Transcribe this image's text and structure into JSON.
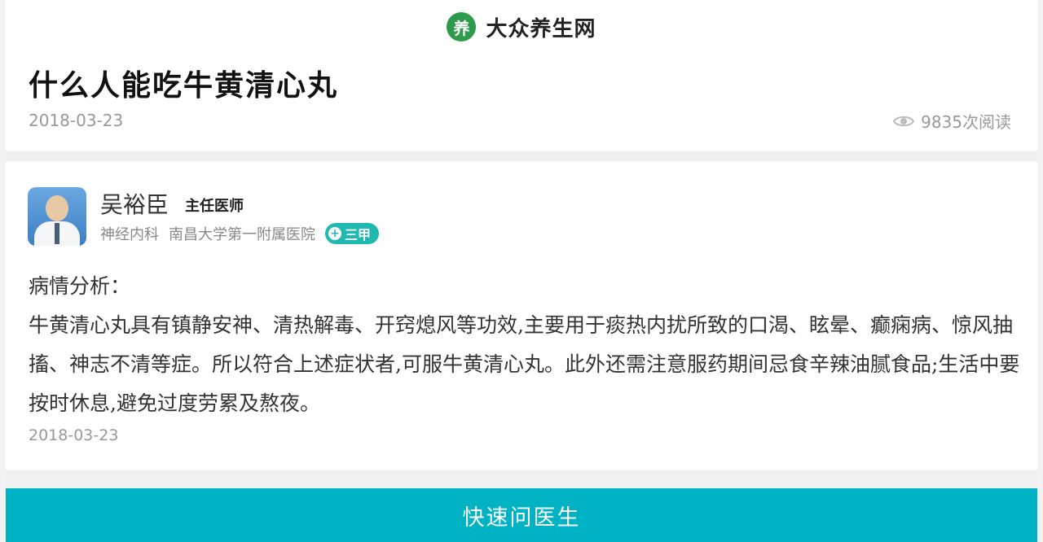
{
  "site": {
    "name": "大众养生网",
    "logo_char": "养"
  },
  "article": {
    "title": "什么人能吃牛黄清心丸",
    "date": "2018-03-23",
    "read_count": "9835次阅读"
  },
  "doctor": {
    "name": "吴裕臣",
    "title": "主任医师",
    "department": "神经内科",
    "hospital": "南昌大学第一附属医院",
    "grade": "三甲"
  },
  "answer": {
    "heading": "病情分析：",
    "text": "牛黄清心丸具有镇静安神、清热解毒、开窍熄风等功效,主要用于痰热内扰所致的口渴、眩晕、癫痫病、惊风抽搐、神志不清等症。所以符合上述症状者,可服牛黄清心丸。此外还需注意服药期间忌食辛辣油腻食品;生活中要按时休息,避免过度劳累及熬夜。",
    "date": "2018-03-23"
  },
  "cta": {
    "label": "快速问医生"
  },
  "colors": {
    "brand_green": "#2e9a4b",
    "badge_teal": "#1fb9b0",
    "cta_cyan": "#00b3c4"
  }
}
